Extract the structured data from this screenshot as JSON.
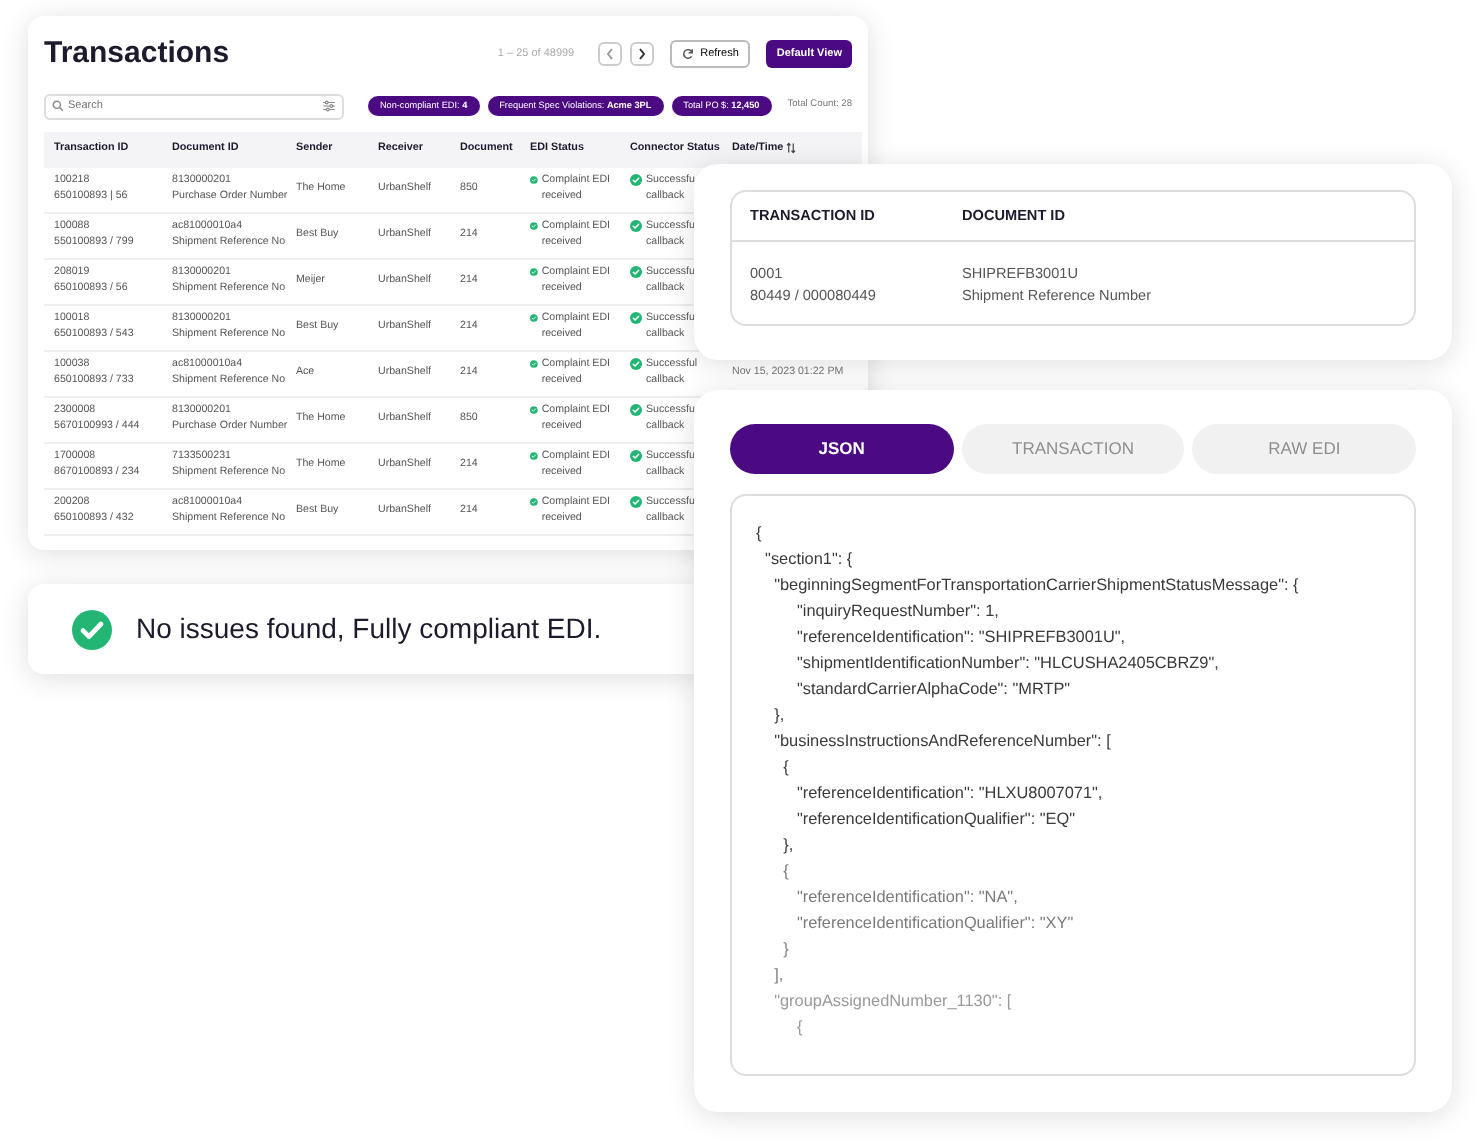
{
  "transactions": {
    "title": "Transactions",
    "pagination": "1 – 25 of 48999",
    "refresh_button": "Refresh",
    "default_view_button": "Default View",
    "search": {
      "placeholder": "Search"
    },
    "chips": [
      "Non-compliant EDI: **4**",
      "Frequent Spec Violations: **Acme 3PL**",
      "Total PO $: **12,450**"
    ],
    "total_count": "Total Count: 28",
    "columns": [
      "Transaction ID",
      "Document ID",
      "Sender",
      "Receiver",
      "Document",
      "EDI Status",
      "Connector Status",
      "Date/Time"
    ],
    "rows": [
      {
        "transaction_id": [
          "100218",
          "650100893 | 56"
        ],
        "document_id": [
          "8130000201",
          "Purchase Order Number"
        ],
        "sender": "The Home",
        "receiver": "UrbanShelf",
        "document": "850",
        "edi_status": [
          "Complaint EDI",
          "received"
        ],
        "connector_status": [
          "Successfu",
          "callback"
        ]
      },
      {
        "transaction_id": [
          "100088",
          "550100893 / 799"
        ],
        "document_id": [
          "ac81000010a4",
          "Shipment Reference No"
        ],
        "sender": "Best Buy",
        "receiver": "UrbanShelf",
        "document": "214",
        "edi_status": [
          "Complaint EDI",
          "received"
        ],
        "connector_status": [
          "Successfu",
          "callback"
        ]
      },
      {
        "transaction_id": [
          "208019",
          "650100893 / 56"
        ],
        "document_id": [
          "8130000201",
          "Shipment Reference No"
        ],
        "sender": "Meijer",
        "receiver": "UrbanShelf",
        "document": "214",
        "edi_status": [
          "Complaint EDI",
          "received"
        ],
        "connector_status": [
          "Successfu",
          "callback"
        ]
      },
      {
        "transaction_id": [
          "100018",
          "650100893 / 543"
        ],
        "document_id": [
          "8130000201",
          "Shipment Reference No"
        ],
        "sender": "Best Buy",
        "receiver": "UrbanShelf",
        "document": "214",
        "edi_status": [
          "Complaint EDI",
          "received"
        ],
        "connector_status": [
          "Successfu",
          "callback"
        ]
      },
      {
        "transaction_id": [
          "100038",
          "650100893 / 733"
        ],
        "document_id": [
          "ac81000010a4",
          "Shipment Reference No"
        ],
        "sender": "Ace",
        "receiver": "UrbanShelf",
        "document": "214",
        "edi_status": [
          "Complaint EDI",
          "received"
        ],
        "connector_status": [
          "Successful",
          "callback"
        ],
        "date_time": "Nov 15, 2023 01:22 PM"
      },
      {
        "transaction_id": [
          "2300008",
          "5670100993 / 444"
        ],
        "document_id": [
          "8130000201",
          "Purchase Order Number"
        ],
        "sender": "The Home",
        "receiver": "UrbanShelf",
        "document": "850",
        "edi_status": [
          "Complaint EDI",
          "received"
        ],
        "connector_status": [
          "Successfu",
          "callback"
        ]
      },
      {
        "transaction_id": [
          "1700008",
          "8670100893 / 234"
        ],
        "document_id": [
          "7133500231",
          "Shipment Reference No"
        ],
        "sender": "The Home",
        "receiver": "UrbanShelf",
        "document": "214",
        "edi_status": [
          "Complaint EDI",
          "received"
        ],
        "connector_status": [
          "Successfu",
          "callback"
        ]
      },
      {
        "transaction_id": [
          "200208",
          "650100893 / 432"
        ],
        "document_id": [
          "ac81000010a4",
          "Shipment Reference No"
        ],
        "sender": "Best Buy",
        "receiver": "UrbanShelf",
        "document": "214",
        "edi_status": [
          "Complaint EDI",
          "received"
        ],
        "connector_status": [
          "Successfu",
          "callback"
        ]
      }
    ]
  },
  "toast": {
    "message": "No issues found, Fully compliant EDI."
  },
  "detail": {
    "columns": [
      "TRANSACTION ID",
      "DOCUMENT ID"
    ],
    "transaction_id": [
      "0001",
      "80449 / 000080449"
    ],
    "document_id": [
      "SHIPREFB3001U",
      "Shipment Reference Number"
    ]
  },
  "viewer": {
    "tabs": [
      {
        "label": "JSON",
        "selected": true
      },
      {
        "label": "TRANSACTION",
        "selected": false
      },
      {
        "label": "RAW EDI",
        "selected": false
      }
    ],
    "code_lines": [
      {
        "text": "{",
        "color": "#3a3a3a"
      },
      {
        "text": "  \"section1\": {",
        "color": "#3a3a3a"
      },
      {
        "text": "    \"beginningSegmentForTransportationCarrierShipmentStatusMessage\": {",
        "color": "#3a3a3a"
      },
      {
        "text": "         \"inquiryRequestNumber\": 1,",
        "color": "#3a3a3a"
      },
      {
        "text": "         \"referenceIdentification\": \"SHIPREFB3001U\",",
        "color": "#3a3a3a"
      },
      {
        "text": "         \"shipmentIdentificationNumber\": \"HLCUSHA2405CBRZ9\",",
        "color": "#3a3a3a"
      },
      {
        "text": "         \"standardCarrierAlphaCode\": \"MRTP\"",
        "color": "#3a3a3a"
      },
      {
        "text": "    },",
        "color": "#3a3a3a"
      },
      {
        "text": "    \"businessInstructionsAndReferenceNumber\": [",
        "color": "#3a3a3a"
      },
      {
        "text": "      {",
        "color": "#3a3a3a"
      },
      {
        "text": "         \"referenceIdentification\": \"HLXU8007071\",",
        "color": "#3a3a3a"
      },
      {
        "text": "         \"referenceIdentificationQualifier\": \"EQ\"",
        "color": "#3a3a3a"
      },
      {
        "text": "      },",
        "color": "#3a3a3a"
      },
      {
        "text": "      {",
        "color": "#7a7a7a"
      },
      {
        "text": "         \"referenceIdentification\": \"NA\",",
        "color": "#7a7a7a"
      },
      {
        "text": "         \"referenceIdentificationQualifier\": \"XY\"",
        "color": "#7a7a7a"
      },
      {
        "text": "      }",
        "color": "#808080"
      },
      {
        "text": "    ],"
      },
      {
        "text": "    \"groupAssignedNumber_1130\": [",
        "color": "#999999"
      },
      {
        "text": "         {",
        "color": "#999999"
      }
    ]
  }
}
